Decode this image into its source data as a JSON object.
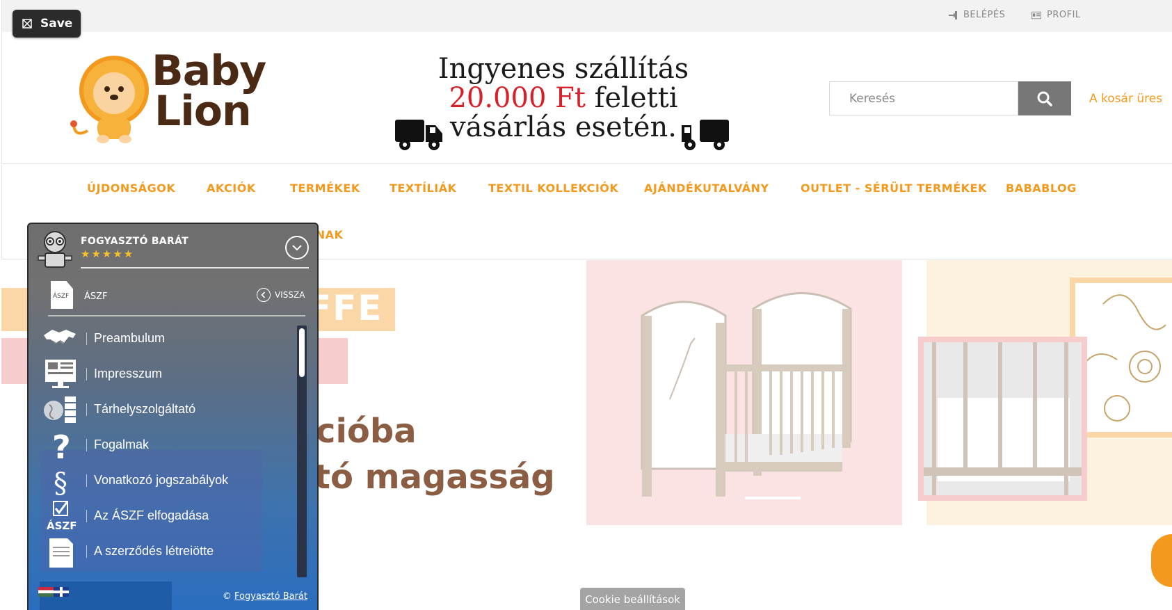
{
  "toolbar": {
    "save_label": "Save"
  },
  "topbar": {
    "login_label": "BELÉPÉS",
    "profile_label": "PROFIL"
  },
  "logo": {
    "line1": "Baby",
    "line2": "Lion"
  },
  "promo": {
    "line1": "Ingyenes szállítás",
    "amount": "20.000 Ft",
    "line2_rest": " feletti",
    "line3": "vásárlás esetén."
  },
  "search": {
    "placeholder": "Keresés",
    "value": ""
  },
  "cart": {
    "label": "A kosár üres"
  },
  "nav": {
    "items": [
      "ÚJDONSÁGOK",
      "AKCIÓK",
      "TERMÉKEK",
      "TEXTÍLIÁK",
      "TEXTIL KOLLEKCIÓK",
      "AJÁNDÉKUTALVÁNY",
      "OUTLET - SÉRÜLT TERMÉKEK",
      "BABABLOG",
      "DÓKNAK"
    ]
  },
  "banner": {
    "headline_top": "FFE",
    "line1": "cióba",
    "line2": "tó magasság"
  },
  "cookie": {
    "label": "Cookie beállítások"
  },
  "widget": {
    "title": "FOGYASZTÓ BARÁT",
    "stars": "★★★★★",
    "doc_icon_text": "ÁSZF",
    "section_title": "ÁSZF",
    "back_label": "VISSZA",
    "items": [
      {
        "label": "Preambulum",
        "icon": "handshake-icon"
      },
      {
        "label": "Impresszum",
        "icon": "monitor-icon"
      },
      {
        "label": "Tárhelyszolgáltató",
        "icon": "globe-server-icon"
      },
      {
        "label": "Fogalmak",
        "icon": "question-mark-icon"
      },
      {
        "label": "Vonatkozó jogszabályok",
        "icon": "paragraph-icon"
      },
      {
        "label": "Az ÁSZF elfogadása",
        "icon": "aszf-check-icon"
      },
      {
        "label": "A szerződés létreiötte",
        "icon": "document-icon"
      }
    ],
    "check_icon_text": "ÁSZF",
    "copyright_symbol": "©",
    "copyright_link": "Fogyasztó Barát"
  }
}
